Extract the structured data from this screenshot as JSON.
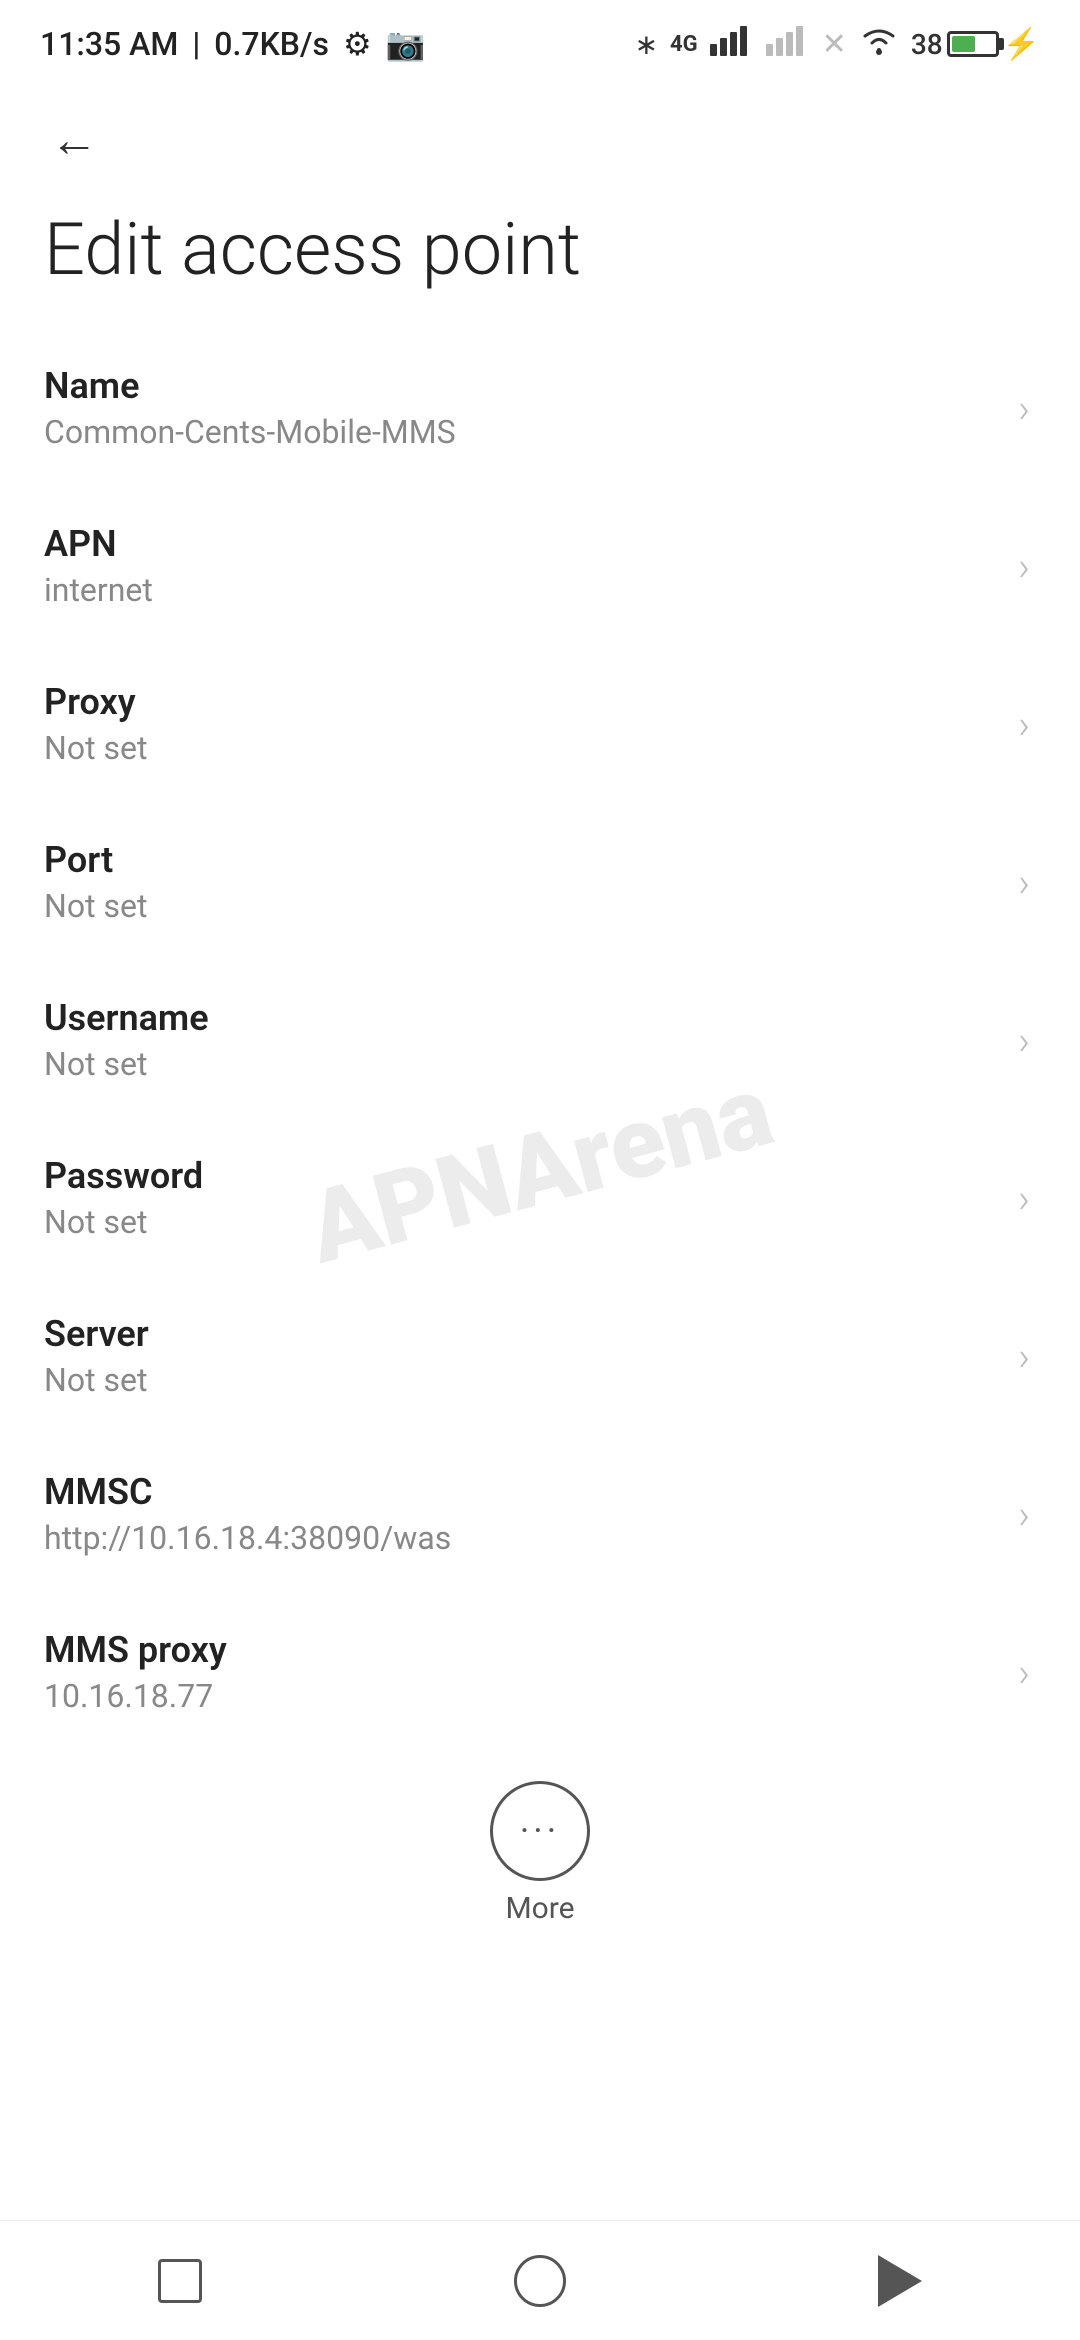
{
  "statusBar": {
    "time": "11:35 AM",
    "speed": "0.7KB/s"
  },
  "page": {
    "title": "Edit access point",
    "back_label": "Back"
  },
  "fields": [
    {
      "id": "name",
      "label": "Name",
      "value": "Common-Cents-Mobile-MMS"
    },
    {
      "id": "apn",
      "label": "APN",
      "value": "internet"
    },
    {
      "id": "proxy",
      "label": "Proxy",
      "value": "Not set"
    },
    {
      "id": "port",
      "label": "Port",
      "value": "Not set"
    },
    {
      "id": "username",
      "label": "Username",
      "value": "Not set"
    },
    {
      "id": "password",
      "label": "Password",
      "value": "Not set"
    },
    {
      "id": "server",
      "label": "Server",
      "value": "Not set"
    },
    {
      "id": "mmsc",
      "label": "MMSC",
      "value": "http://10.16.18.4:38090/was"
    },
    {
      "id": "mms-proxy",
      "label": "MMS proxy",
      "value": "10.16.18.77"
    }
  ],
  "more": {
    "label": "More"
  },
  "watermark": "APNArena"
}
